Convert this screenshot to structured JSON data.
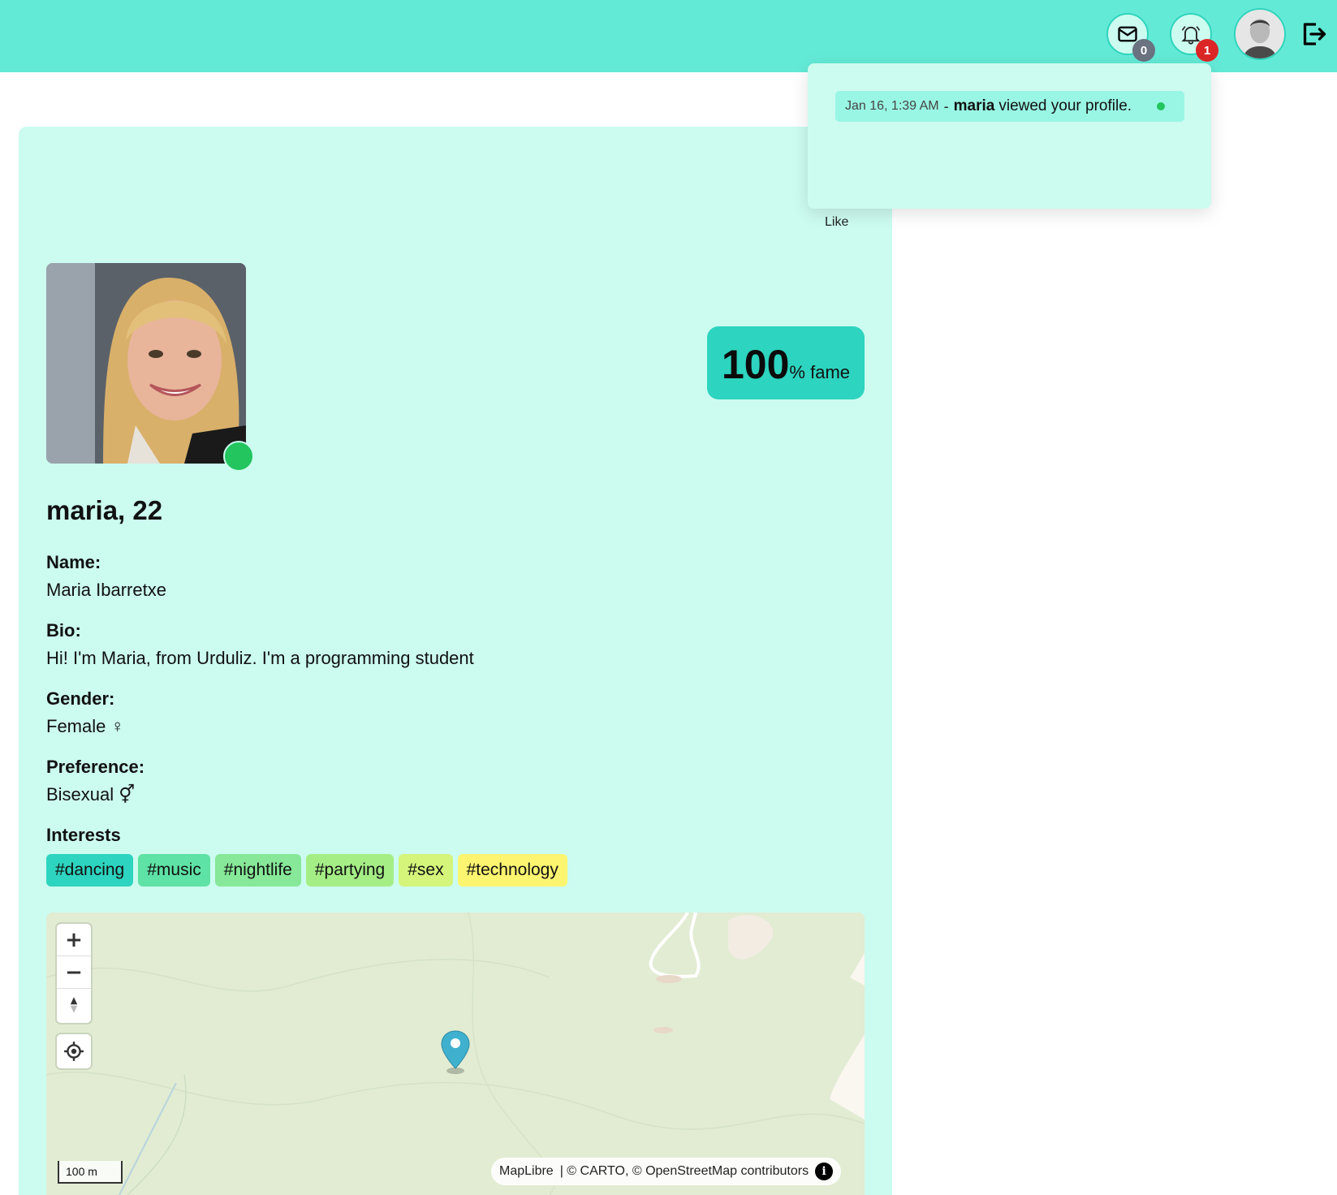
{
  "header": {
    "messages_count": "0",
    "notifications_count": "1",
    "colors": {
      "bar": "#63ead6",
      "badge_messages": "#6b7280",
      "badge_notifications": "#dc2626"
    }
  },
  "notifications": [
    {
      "time": "Jan 16, 1:39 AM",
      "separator": "-",
      "user": "maria",
      "text": "viewed your profile.",
      "unread": true
    }
  ],
  "profile": {
    "like_label": "Like",
    "online": true,
    "fame_value": "100",
    "fame_unit": "% fame",
    "name_age": "maria, 22",
    "fields": {
      "name_label": "Name:",
      "name_value": "Maria Ibarretxe",
      "bio_label": "Bio:",
      "bio_value": "Hi! I'm Maria, from Urduliz. I'm a programming student",
      "gender_label": "Gender:",
      "gender_value": "Female ♀",
      "preference_label": "Preference:",
      "preference_value": "Bisexual ⚥"
    },
    "interests_label": "Interests",
    "interests": [
      "#dancing",
      "#music",
      "#nightlife",
      "#partying",
      "#sex",
      "#technology"
    ],
    "interest_colors": [
      "#2dd4bf",
      "#5ee2a5",
      "#86e898",
      "#a5ee86",
      "#d4f57a",
      "#fdf570"
    ]
  },
  "map": {
    "zoom_in": "+",
    "zoom_out": "−",
    "compass": "▲",
    "scale": "100 m",
    "attribution_maplibre": "MapLibre",
    "attribution_rest": "| © CARTO, © OpenStreetMap contributors",
    "info": "i"
  }
}
